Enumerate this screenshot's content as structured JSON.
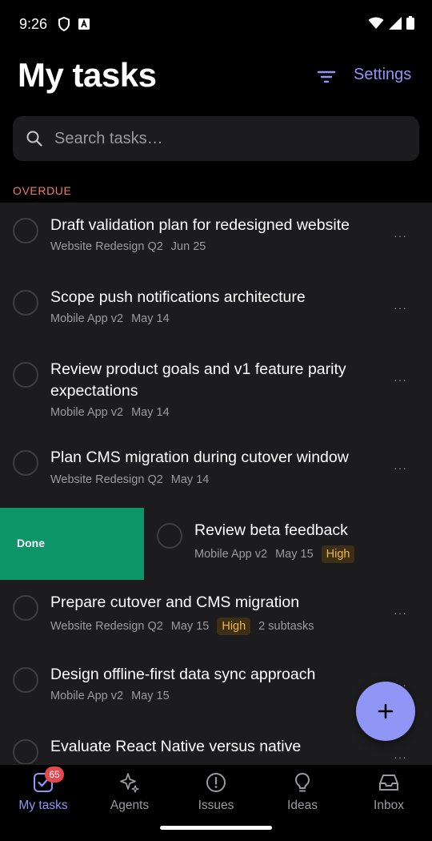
{
  "status": {
    "time": "9:26"
  },
  "header": {
    "title": "My tasks",
    "settings_label": "Settings"
  },
  "search": {
    "placeholder": "Search tasks…",
    "value": ""
  },
  "section": {
    "label": "OVERDUE"
  },
  "tasks": [
    {
      "title": "Draft validation plan for redesigned website",
      "project": "Website Redesign Q2",
      "due": "Jun 25",
      "more": "···"
    },
    {
      "title": "Scope push notifications architecture",
      "project": "Mobile App v2",
      "due": "May 14",
      "more": "···"
    },
    {
      "title": "Review product goals and v1 feature parity expectations",
      "project": "Mobile App v2",
      "due": "May 14",
      "more": "···"
    },
    {
      "title": "Plan CMS migration during cutover window",
      "project": "Website Redesign Q2",
      "due": "May 14",
      "more": "···"
    },
    {
      "title": "Review beta feedback",
      "project": "Mobile App v2",
      "due": "May 15",
      "priority": "High",
      "swipe_action": "Done"
    },
    {
      "title": "Prepare cutover and CMS migration",
      "project": "Website Redesign Q2",
      "due": "May 15",
      "priority": "High",
      "subtasks": "2 subtasks",
      "more": "···"
    },
    {
      "title": "Design offline-first data sync approach",
      "project": "Mobile App v2",
      "due": "May 15",
      "more": "···"
    },
    {
      "title": "Evaluate React Native versus native",
      "more": "···"
    }
  ],
  "fab": {
    "icon": "plus-icon"
  },
  "tabbar": {
    "items": [
      {
        "label": "My tasks",
        "icon": "checkbox-icon",
        "badge": "65",
        "active": true
      },
      {
        "label": "Agents",
        "icon": "sparkle-icon"
      },
      {
        "label": "Issues",
        "icon": "alert-circle-icon"
      },
      {
        "label": "Ideas",
        "icon": "lightbulb-icon"
      },
      {
        "label": "Inbox",
        "icon": "inbox-icon"
      }
    ]
  },
  "colors": {
    "accent": "#8f96f5",
    "overdue": "#f07a6a",
    "done": "#0d9467",
    "high_priority": "#f0b64a",
    "badge": "#e5484d"
  }
}
